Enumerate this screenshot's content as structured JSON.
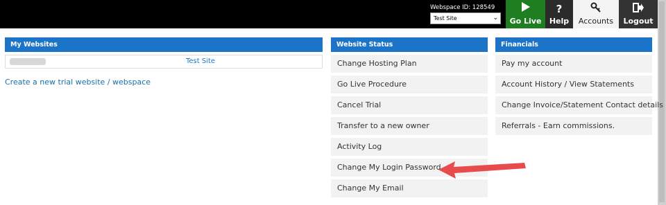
{
  "topbar": {
    "webspace_label": "Webspace ID: 128549",
    "webspace_select": "Test Site",
    "buttons": {
      "golive": "Go Live",
      "help": "Help",
      "accounts": "Accounts",
      "logout": "Logout"
    }
  },
  "my_websites": {
    "title": "My Websites",
    "site_name": "Test Site",
    "create_link": "Create a new trial website / webspace"
  },
  "website_status": {
    "title": "Website Status",
    "items": [
      "Change Hosting Plan",
      "Go Live Procedure",
      "Cancel Trial",
      "Transfer to a new owner",
      "Activity Log",
      "Change My Login Password",
      "Change My Email"
    ]
  },
  "financials": {
    "title": "Financials",
    "items": [
      "Pay my account",
      "Account History / View Statements",
      "Change Invoice/Statement Contact details",
      "Referrals - Earn commissions."
    ]
  },
  "colors": {
    "header_blue": "#1c74c8",
    "go_live_green": "#1f7e1f",
    "annotation_arrow": "#e84b4b"
  }
}
